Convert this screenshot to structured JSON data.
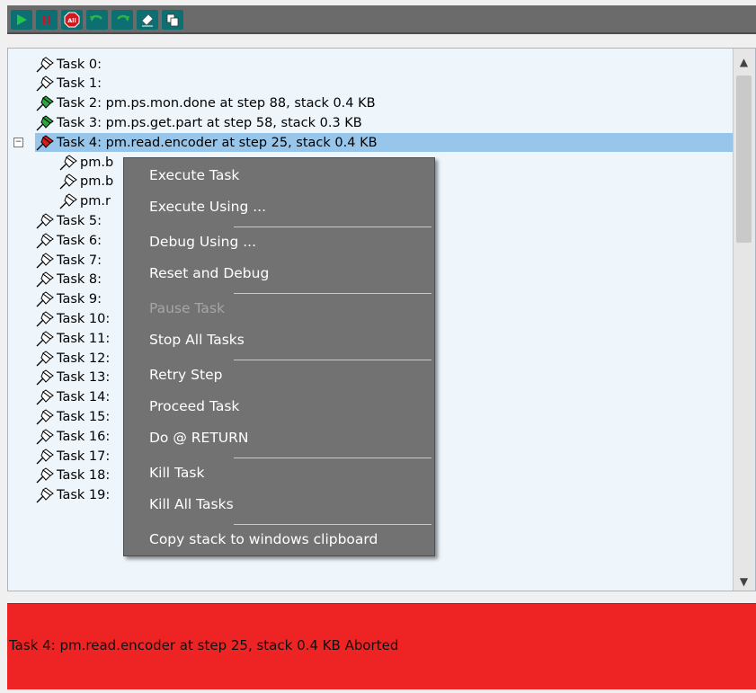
{
  "toolbar": {
    "buttons": [
      {
        "name": "run",
        "icon": "play-icon",
        "color": "#27c24c"
      },
      {
        "name": "pause",
        "icon": "pause-icon",
        "color": "#c2172a"
      },
      {
        "name": "abort-all",
        "icon": "abort-all-icon",
        "label": "All",
        "color": "#d3191e"
      },
      {
        "name": "undo",
        "icon": "undo-icon",
        "color": "#2ab34a"
      },
      {
        "name": "redo",
        "icon": "redo-icon",
        "color": "#2ab34a"
      },
      {
        "name": "eraser",
        "icon": "eraser-icon"
      },
      {
        "name": "copy",
        "icon": "copy-icon"
      }
    ]
  },
  "tree": {
    "rows": [
      {
        "text": "Task 0:",
        "pin": "white"
      },
      {
        "text": "Task 1:",
        "pin": "white"
      },
      {
        "text": "Task 2: pm.ps.mon.done at step 88, stack 0.4 KB",
        "pin": "green"
      },
      {
        "text": "Task 3: pm.ps.get.part at step 58, stack 0.3 KB",
        "pin": "green"
      },
      {
        "text": "Task 4: pm.read.encoder at step 25, stack 0.4 KB",
        "pin": "red",
        "selected": true,
        "expanded": true
      },
      {
        "text": "pm.b",
        "pin": "white",
        "child": true
      },
      {
        "text": "pm.b",
        "pin": "white",
        "child": true
      },
      {
        "text": "pm.r",
        "pin": "white",
        "child": true
      },
      {
        "text": "Task 5:",
        "pin": "white"
      },
      {
        "text": "Task 6:",
        "pin": "white"
      },
      {
        "text": "Task 7:",
        "pin": "white"
      },
      {
        "text": "Task 8:",
        "pin": "white"
      },
      {
        "text": "Task 9:",
        "pin": "white"
      },
      {
        "text": "Task 10:",
        "pin": "white"
      },
      {
        "text": "Task 11:",
        "pin": "white"
      },
      {
        "text": "Task 12:",
        "pin": "white"
      },
      {
        "text": "Task 13:",
        "pin": "white"
      },
      {
        "text": "Task 14:",
        "pin": "white"
      },
      {
        "text": "Task 15:",
        "pin": "white"
      },
      {
        "text": "Task 16:",
        "pin": "white"
      },
      {
        "text": "Task 17:",
        "pin": "white"
      },
      {
        "text": "Task 18:",
        "pin": "white"
      },
      {
        "text": "Task 19:",
        "pin": "white"
      }
    ]
  },
  "context_menu": {
    "items": [
      {
        "label": "Execute Task"
      },
      {
        "label": "Execute Using ..."
      },
      {
        "separator": true
      },
      {
        "label": "Debug Using ..."
      },
      {
        "label": "Reset and Debug"
      },
      {
        "separator": true
      },
      {
        "label": "Pause Task",
        "disabled": true
      },
      {
        "label": "Stop All Tasks"
      },
      {
        "separator": true
      },
      {
        "label": "Retry Step"
      },
      {
        "label": "Proceed Task"
      },
      {
        "label": "Do @ RETURN"
      },
      {
        "separator": true
      },
      {
        "label": "Kill Task"
      },
      {
        "label": "Kill All Tasks"
      },
      {
        "separator": true
      },
      {
        "label": "Copy stack to windows clipboard"
      }
    ]
  },
  "status": {
    "text": "Task 4: pm.read.encoder at step 25, stack 0.4 KB Aborted",
    "background": "#ee2424"
  }
}
